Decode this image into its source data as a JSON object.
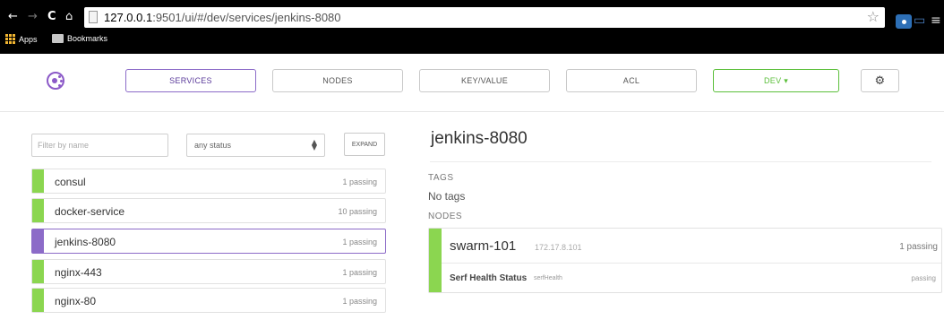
{
  "browser": {
    "url_host": "127.0.0.1",
    "url_path": ":9501/ui/#/dev/services/jenkins-8080",
    "bookmarks": [
      {
        "label": "Apps"
      },
      {
        "label": "Bookmarks"
      }
    ]
  },
  "nav": {
    "services_label": "SERVICES",
    "nodes_label": "NODES",
    "kv_label": "KEY/VALUE",
    "acl_label": "ACL",
    "datacenter_label": "DEV ▾"
  },
  "filters": {
    "name_placeholder": "Filter by name",
    "status_selected": "any status",
    "expand_label": "EXPAND"
  },
  "services": [
    {
      "name": "consul",
      "status": "1 passing"
    },
    {
      "name": "docker-service",
      "status": "10 passing"
    },
    {
      "name": "jenkins-8080",
      "status": "1 passing"
    },
    {
      "name": "nginx-443",
      "status": "1 passing"
    },
    {
      "name": "nginx-80",
      "status": "1 passing"
    }
  ],
  "detail": {
    "title": "jenkins-8080",
    "tags_label": "TAGS",
    "tags_value": "No tags",
    "nodes_label": "NODES",
    "node": {
      "name": "swarm-101",
      "ip": "172.17.8.101",
      "status": "1 passing",
      "check_name": "Serf Health Status",
      "check_id": "serfHealth",
      "check_status": "passing"
    }
  },
  "colors": {
    "passing": "#8bd650",
    "selected": "#8c6bc8",
    "datacenter": "#5bbf3a"
  }
}
